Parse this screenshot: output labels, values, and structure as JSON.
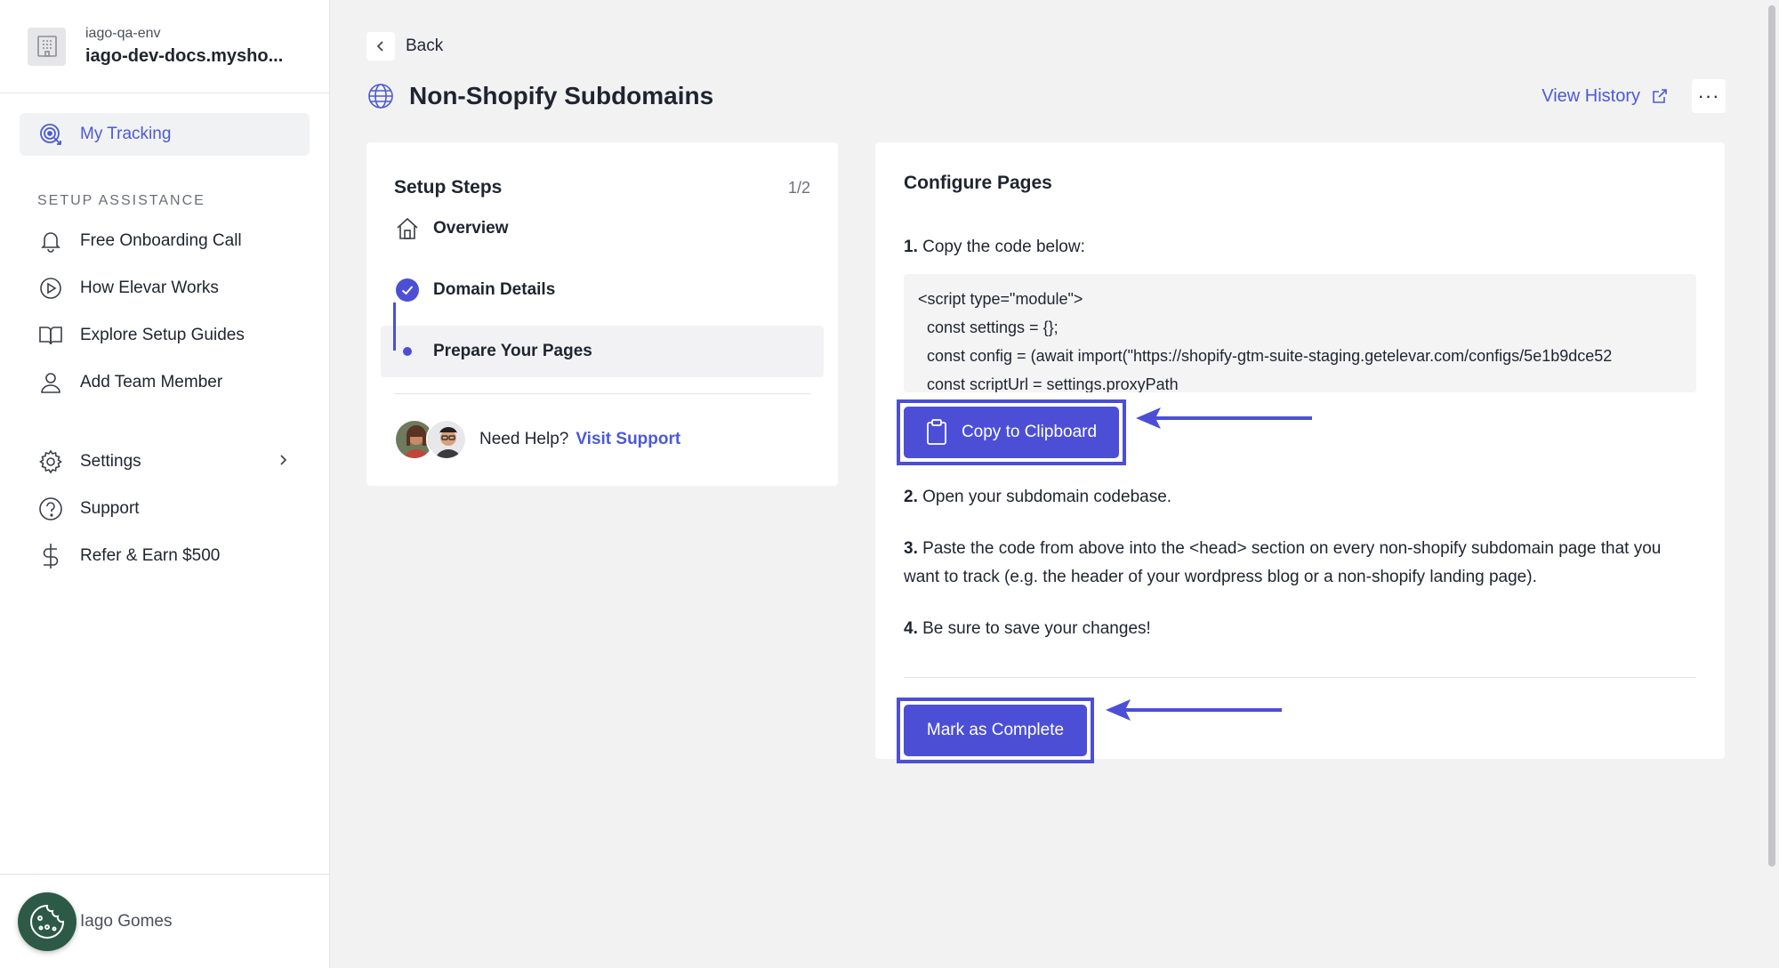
{
  "store": {
    "env": "iago-qa-env",
    "domain": "iago-dev-docs.mysho..."
  },
  "sidebar": {
    "tracking": "My Tracking",
    "section_label": "SETUP ASSISTANCE",
    "items": [
      {
        "label": "Free Onboarding Call",
        "icon": "bell-icon"
      },
      {
        "label": "How Elevar Works",
        "icon": "play-circle-icon"
      },
      {
        "label": "Explore Setup Guides",
        "icon": "book-icon"
      },
      {
        "label": "Add Team Member",
        "icon": "user-icon"
      }
    ],
    "bottom_items": [
      {
        "label": "Settings",
        "icon": "gear-icon"
      },
      {
        "label": "Support",
        "icon": "help-circle-icon"
      },
      {
        "label": "Refer & Earn $500",
        "icon": "dollar-icon"
      }
    ]
  },
  "user": {
    "name": "Iago Gomes"
  },
  "header": {
    "back_label": "Back",
    "title": "Non-Shopify Subdomains",
    "view_history": "View History",
    "more": "···"
  },
  "steps": {
    "title": "Setup Steps",
    "count": "1/2",
    "items": [
      {
        "label": "Overview",
        "state": "overview"
      },
      {
        "label": "Domain Details",
        "state": "complete"
      },
      {
        "label": "Prepare Your Pages",
        "state": "current"
      }
    ],
    "help_text": "Need Help?",
    "help_link": "Visit Support"
  },
  "configure": {
    "title": "Configure Pages",
    "step1_num": "1.",
    "step1_text": " Copy the code below:",
    "code_lines": [
      "<script type=\"module\">",
      "const settings = {};",
      "const config = (await import(\"https://shopify-gtm-suite-staging.getelevar.com/configs/5e1b9dce52",
      "const scriptUrl = settings.proxyPath"
    ],
    "copy_button": "Copy to Clipboard",
    "step2_num": "2.",
    "step2_text": " Open your subdomain codebase.",
    "step3_num": "3.",
    "step3_text": " Paste the code from above into the <head> section on every non-shopify subdomain page that you want to track (e.g. the header of your wordpress blog or a non-shopify landing page).",
    "step4_num": "4.",
    "step4_text": " Be sure to save your changes!",
    "complete_button": "Mark as Complete"
  },
  "colors": {
    "accent": "#4c4fd6",
    "link": "#4c5ad6",
    "background": "#f2f2f3",
    "cookie_button": "#2c5a47"
  }
}
